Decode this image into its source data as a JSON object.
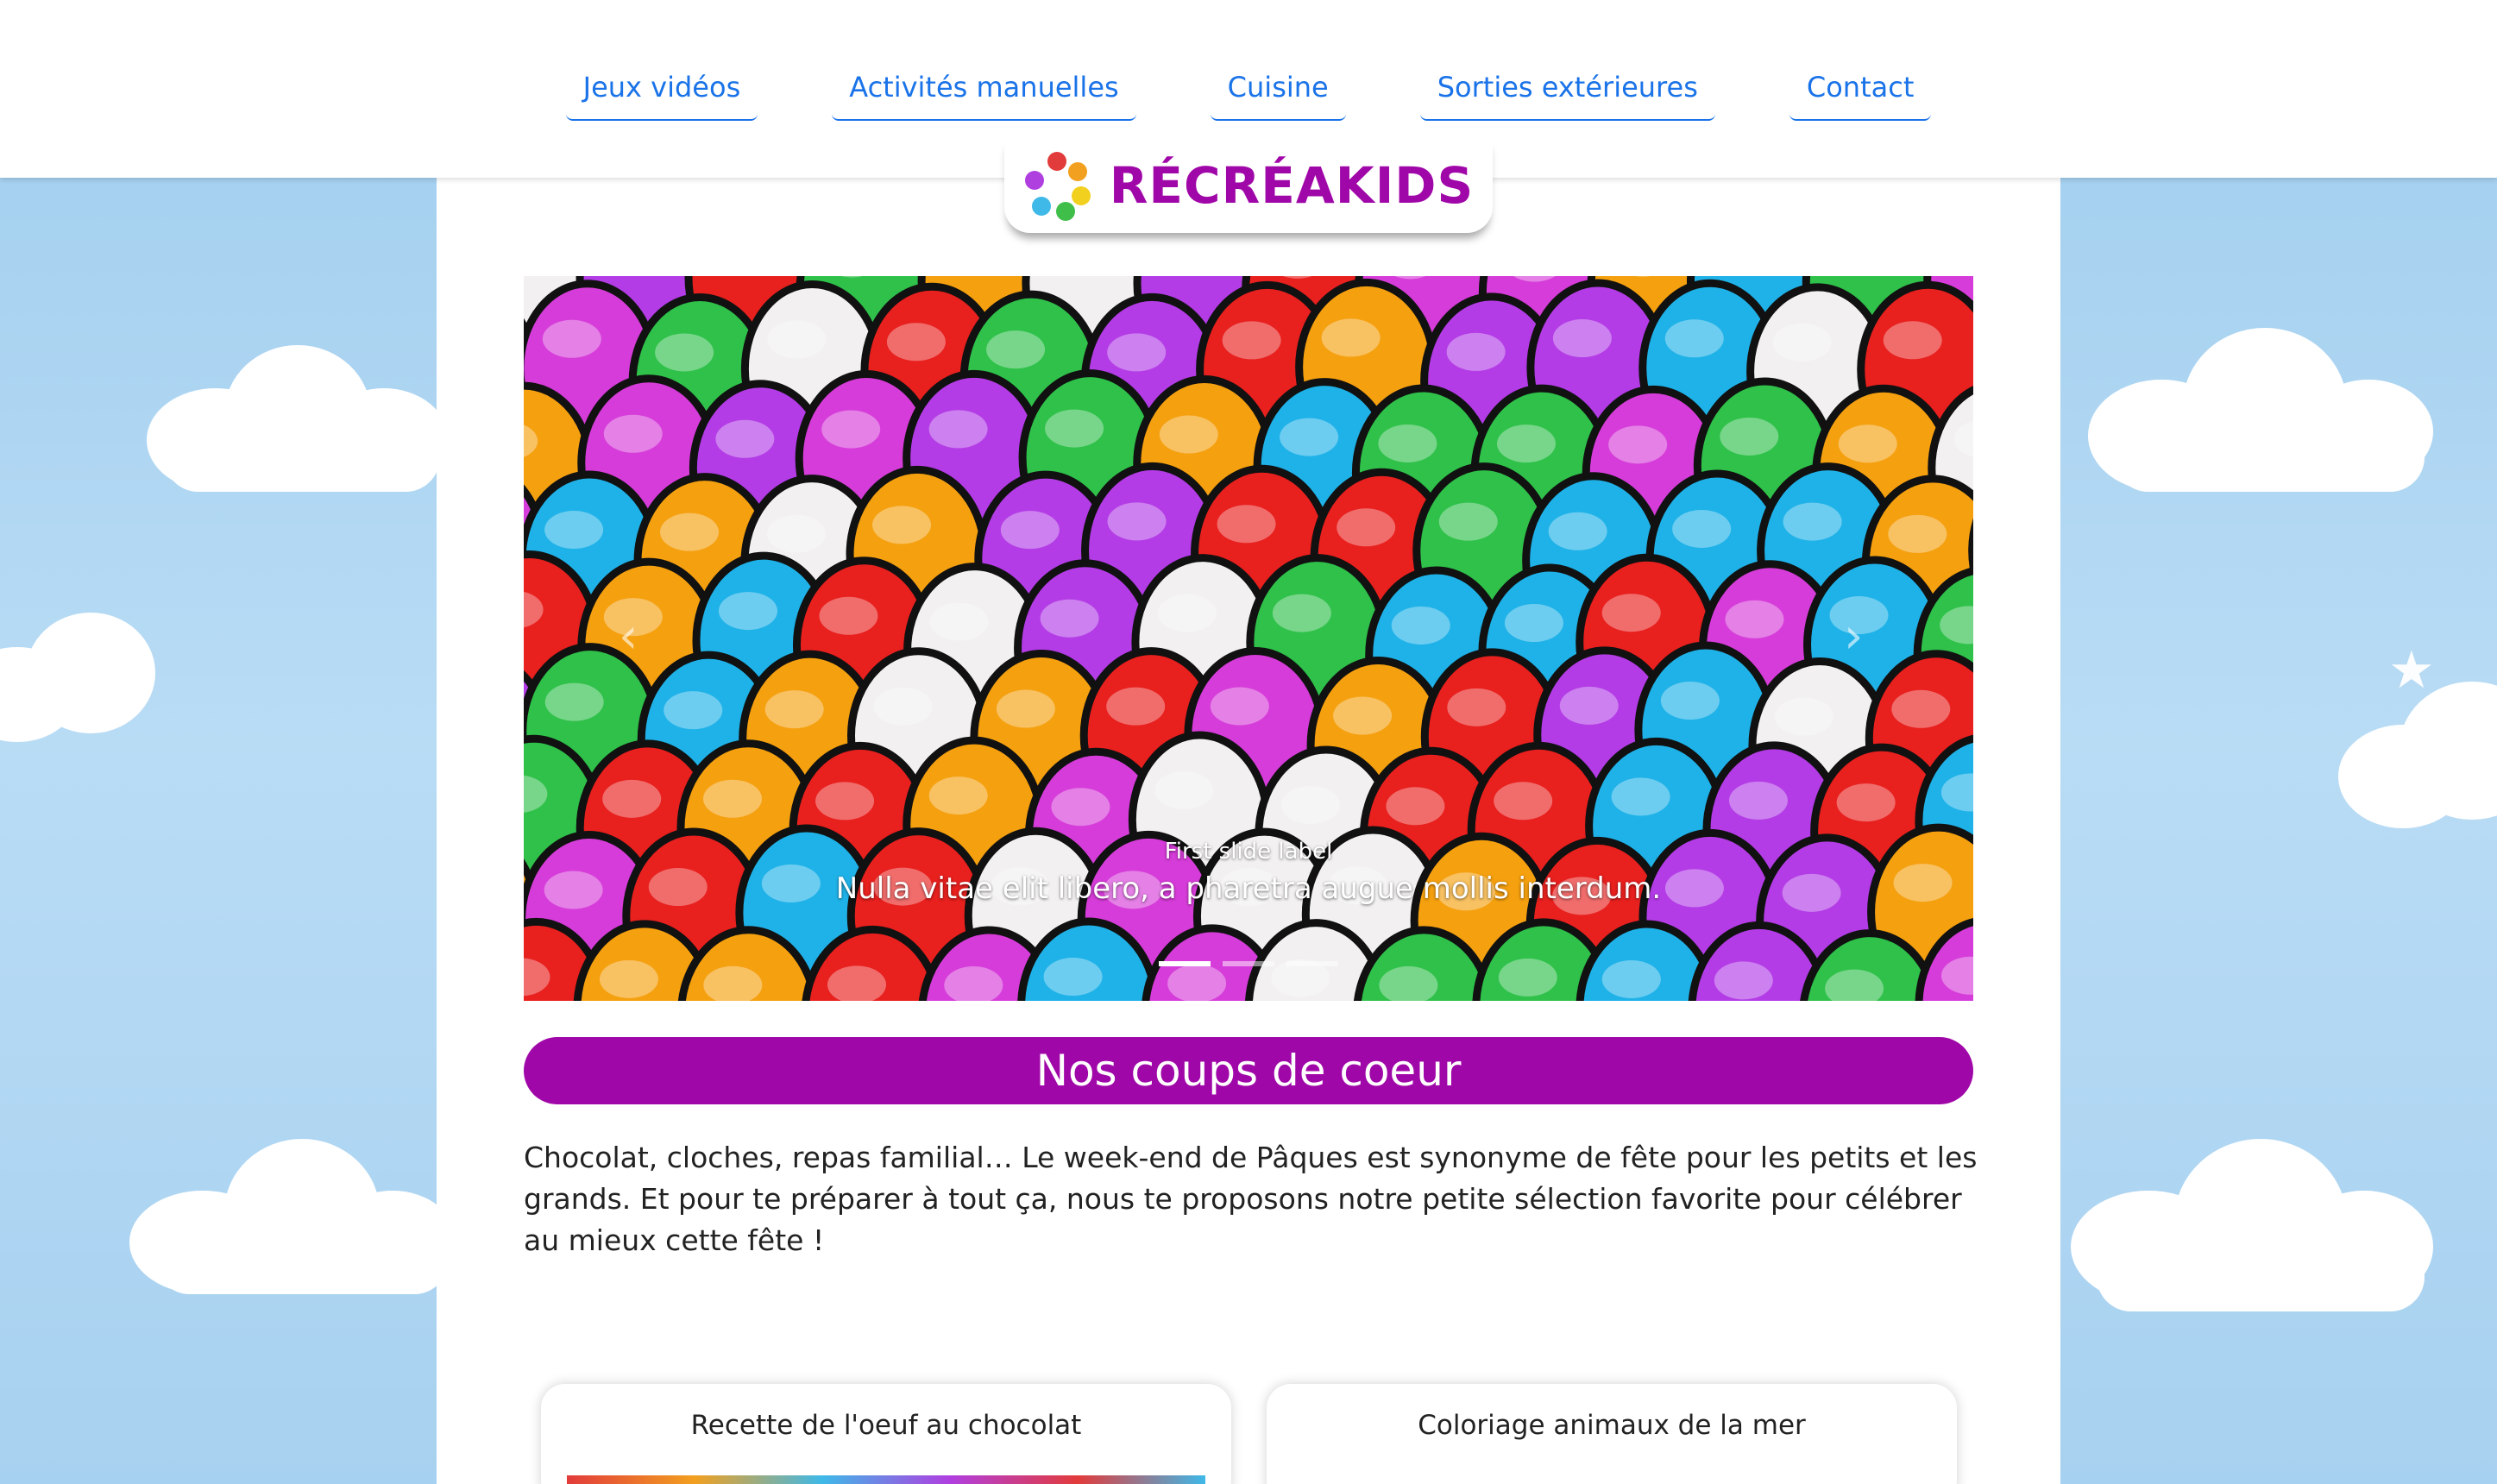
{
  "nav": {
    "items": [
      {
        "label": "Jeux vidéos"
      },
      {
        "label": "Activités manuelles"
      },
      {
        "label": "Cuisine"
      },
      {
        "label": "Sorties extérieures"
      },
      {
        "label": "Contact"
      }
    ]
  },
  "brand": {
    "name": "RÉCRÉAKIDS",
    "logo_icon": "colorful-hands-logo",
    "color": "#a007a8"
  },
  "carousel": {
    "slide_label": "First slide label",
    "slide_text": "Nulla vitae elit libero, a pharetra augue mollis interdum.",
    "prev_icon": "chevron-left-icon",
    "next_icon": "chevron-right-icon",
    "indicator_count": 3,
    "active_indicator": 0
  },
  "section": {
    "title": "Nos coups de coeur",
    "intro": "Chocolat, cloches, repas familial… Le week-end de Pâques est synonyme de fête pour les petits et les grands. Et pour te préparer à tout ça, nous te proposons notre petite sélection favorite pour célébrer au mieux cette fête !"
  },
  "cards": [
    {
      "title": "Recette de l'oeuf au chocolat"
    },
    {
      "title": "Coloriage animaux de la mer"
    }
  ],
  "colors": {
    "nav_link": "#1a73e8",
    "accent": "#a007a8",
    "sky": "#a9d4f2"
  }
}
